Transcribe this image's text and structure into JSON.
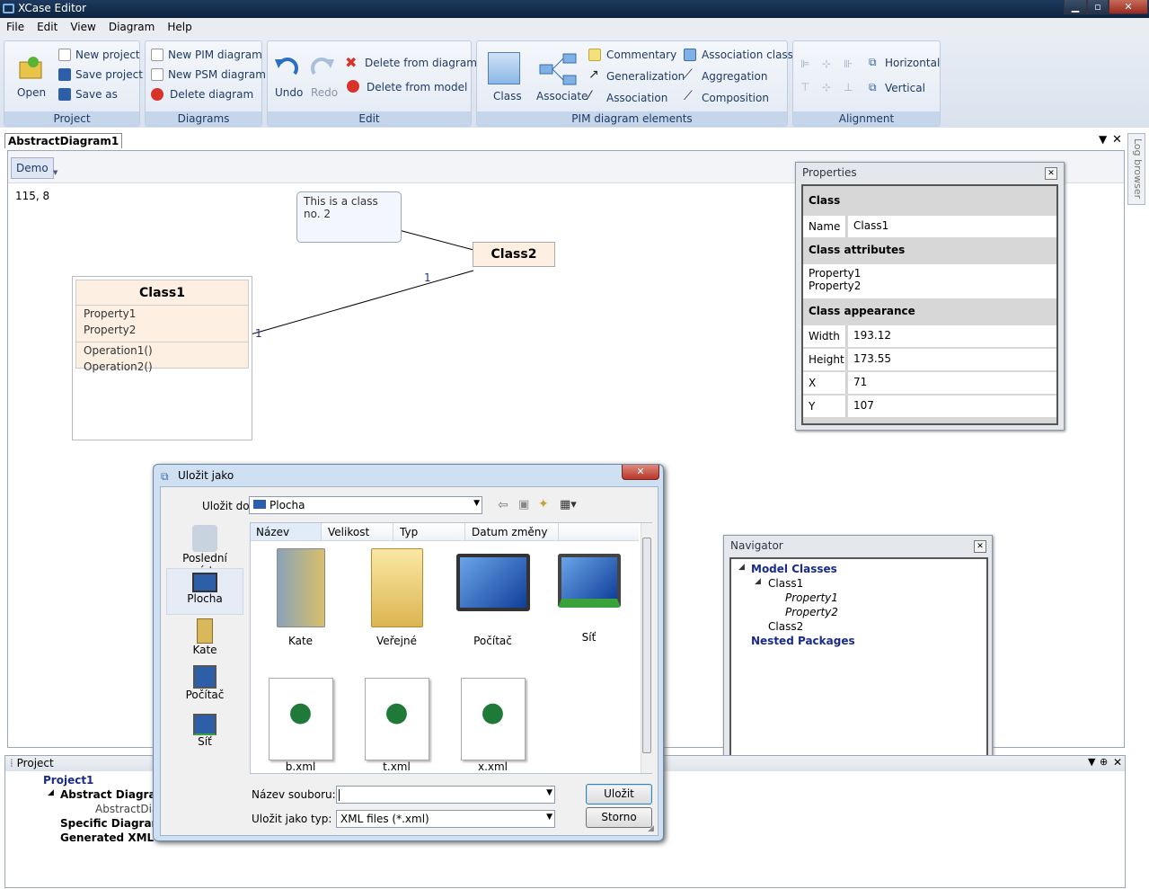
{
  "window": {
    "title": "XCase Editor",
    "min": "▁",
    "max": "▫",
    "close": "✕"
  },
  "menu": [
    "File",
    "Edit",
    "View",
    "Diagram",
    "Help"
  ],
  "ribbon": {
    "project": {
      "open": "Open",
      "new_project": "New project",
      "save_project": "Save project",
      "save_as": "Save as",
      "label": "Project"
    },
    "diagrams": {
      "new_pim": "New PIM diagram",
      "new_psm": "New PSM diagram",
      "delete": "Delete diagram",
      "label": "Diagrams"
    },
    "edit": {
      "undo": "Undo",
      "redo": "Redo",
      "delete_from_diagram": "Delete from diagram",
      "delete_from_model": "Delete from model",
      "label": "Edit"
    },
    "pim": {
      "class": "Class",
      "associate": "Associate",
      "commentary": "Commentary",
      "generalization": "Generalization",
      "association": "Association",
      "association_class": "Association class",
      "aggregation": "Aggregation",
      "composition": "Composition",
      "label": "PIM diagram elements"
    },
    "alignment": {
      "horizontal": "Horizontal",
      "vertical": "Vertical",
      "label": "Alignment"
    }
  },
  "document": {
    "tab": "AbstractDiagram1",
    "subtab": "Demo",
    "coords": "115, 8",
    "log_browser": "Log browser"
  },
  "diagram": {
    "comment": "This is a class no. 2",
    "class1": {
      "name": "Class1",
      "attributes": [
        "Property1",
        "Property2"
      ],
      "operations": [
        "Operation1()",
        "Operation2()"
      ]
    },
    "class2": {
      "name": "Class2"
    },
    "mult1": "1",
    "mult2": "1"
  },
  "properties": {
    "title": "Properties",
    "close": "✕",
    "section_class": "Class",
    "name_key": "Name",
    "name_val": "Class1",
    "section_attrs": "Class attributes",
    "attrs": [
      "Property1",
      "Property2"
    ],
    "section_appearance": "Class appearance",
    "rows": [
      {
        "k": "Width",
        "v": "193.12"
      },
      {
        "k": "Height",
        "v": "173.55"
      },
      {
        "k": "X",
        "v": "71"
      },
      {
        "k": "Y",
        "v": "107"
      }
    ]
  },
  "navigator": {
    "title": "Navigator",
    "close": "✕",
    "model_classes": "Model Classes",
    "class1": "Class1",
    "p1": "Property1",
    "p2": "Property2",
    "class2": "Class2",
    "nested": "Nested Packages"
  },
  "project_panel": {
    "title": "Project",
    "project": "Project1",
    "abstract": "Abstract Diagrams",
    "abstract_item": "AbstractDiag",
    "specific": "Specific Diagrams",
    "generated": "Generated XML"
  },
  "dialog": {
    "title": "Uložit jako",
    "close": "✕",
    "save_in_label": "Uložit do:",
    "save_in_value": "Plocha",
    "places": [
      "Poslední místa",
      "Plocha",
      "Kate",
      "Počítač",
      "Síť"
    ],
    "columns": [
      "Název",
      "Velikost",
      "Typ",
      "Datum změny"
    ],
    "items": [
      "Kate",
      "Veřejné",
      "Počítač",
      "Síť",
      "b.xml",
      "t.xml",
      "x.xml"
    ],
    "filename_label": "Název souboru:",
    "filename_value": "",
    "filetype_label": "Uložit jako typ:",
    "filetype_value": "XML files (*.xml)",
    "save": "Uložit",
    "cancel": "Storno"
  }
}
